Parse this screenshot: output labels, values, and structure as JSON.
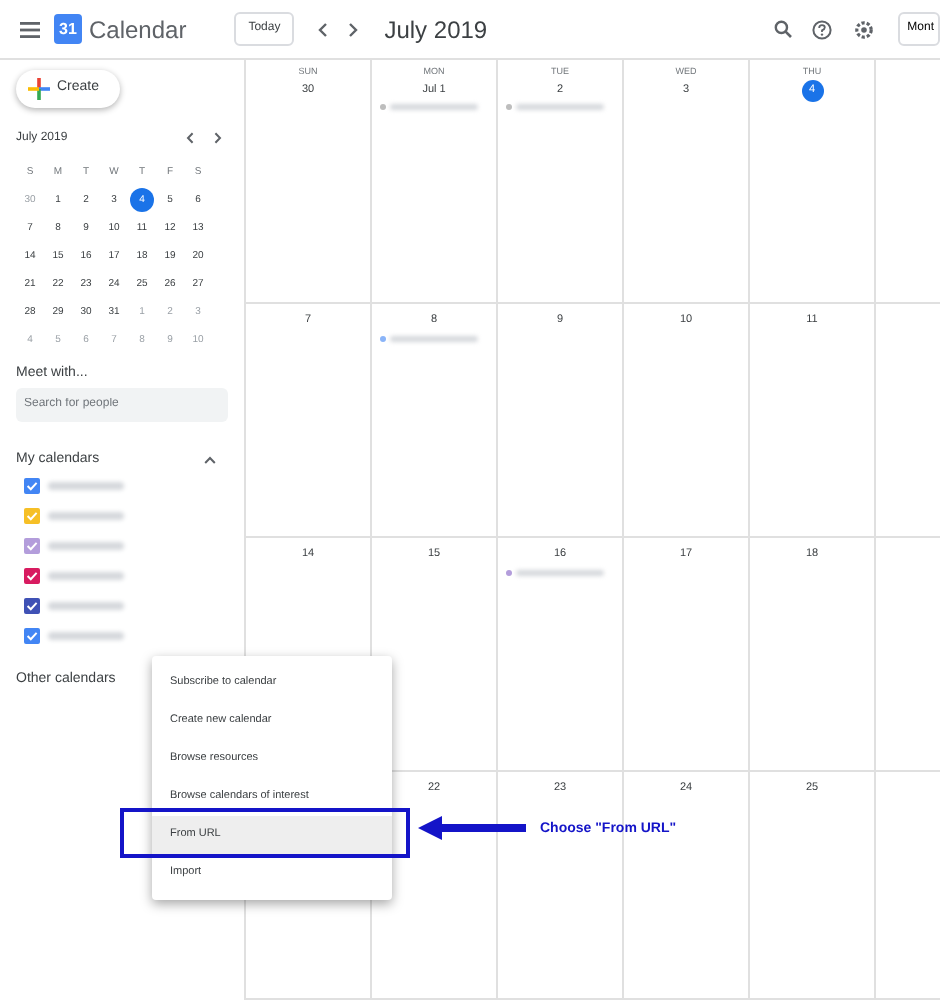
{
  "header": {
    "app_name": "Calendar",
    "logo_text": "31",
    "today_button": "Today",
    "title": "July 2019",
    "view_button": "Mont"
  },
  "create_button": "Create",
  "mini_calendar": {
    "title": "July 2019",
    "weekdays": [
      "S",
      "M",
      "T",
      "W",
      "T",
      "F",
      "S"
    ],
    "weeks": [
      [
        {
          "day": "30",
          "selected": false,
          "outside": true
        },
        {
          "day": "1",
          "selected": false,
          "outside": false
        },
        {
          "day": "2",
          "selected": false,
          "outside": false
        },
        {
          "day": "3",
          "selected": false,
          "outside": false
        },
        {
          "day": "4",
          "selected": true,
          "outside": false
        },
        {
          "day": "5",
          "selected": false,
          "outside": false
        },
        {
          "day": "6",
          "selected": false,
          "outside": false
        }
      ],
      [
        {
          "day": "7",
          "selected": false,
          "outside": false
        },
        {
          "day": "8",
          "selected": false,
          "outside": false
        },
        {
          "day": "9",
          "selected": false,
          "outside": false
        },
        {
          "day": "10",
          "selected": false,
          "outside": false
        },
        {
          "day": "11",
          "selected": false,
          "outside": false
        },
        {
          "day": "12",
          "selected": false,
          "outside": false
        },
        {
          "day": "13",
          "selected": false,
          "outside": false
        }
      ],
      [
        {
          "day": "14",
          "selected": false,
          "outside": false
        },
        {
          "day": "15",
          "selected": false,
          "outside": false
        },
        {
          "day": "16",
          "selected": false,
          "outside": false
        },
        {
          "day": "17",
          "selected": false,
          "outside": false
        },
        {
          "day": "18",
          "selected": false,
          "outside": false
        },
        {
          "day": "19",
          "selected": false,
          "outside": false
        },
        {
          "day": "20",
          "selected": false,
          "outside": false
        }
      ],
      [
        {
          "day": "21",
          "selected": false,
          "outside": false
        },
        {
          "day": "22",
          "selected": false,
          "outside": false
        },
        {
          "day": "23",
          "selected": false,
          "outside": false
        },
        {
          "day": "24",
          "selected": false,
          "outside": false
        },
        {
          "day": "25",
          "selected": false,
          "outside": false
        },
        {
          "day": "26",
          "selected": false,
          "outside": false
        },
        {
          "day": "27",
          "selected": false,
          "outside": false
        }
      ],
      [
        {
          "day": "28",
          "selected": false,
          "outside": false
        },
        {
          "day": "29",
          "selected": false,
          "outside": false
        },
        {
          "day": "30",
          "selected": false,
          "outside": false
        },
        {
          "day": "31",
          "selected": false,
          "outside": false
        },
        {
          "day": "1",
          "selected": false,
          "outside": true
        },
        {
          "day": "2",
          "selected": false,
          "outside": true
        },
        {
          "day": "3",
          "selected": false,
          "outside": true
        }
      ],
      [
        {
          "day": "4",
          "selected": false,
          "outside": true
        },
        {
          "day": "5",
          "selected": false,
          "outside": true
        },
        {
          "day": "6",
          "selected": false,
          "outside": true
        },
        {
          "day": "7",
          "selected": false,
          "outside": true
        },
        {
          "day": "8",
          "selected": false,
          "outside": true
        },
        {
          "day": "9",
          "selected": false,
          "outside": true
        },
        {
          "day": "10",
          "selected": false,
          "outside": true
        }
      ]
    ]
  },
  "meet_with": {
    "title": "Meet with...",
    "placeholder": "Search for people"
  },
  "my_calendars": {
    "title": "My calendars",
    "expanded": true,
    "items": [
      {
        "color": "#4285f4",
        "checked": true
      },
      {
        "color": "#f6bf26",
        "checked": true
      },
      {
        "color": "#b39ddb",
        "checked": true
      },
      {
        "color": "#d81b60",
        "checked": true
      },
      {
        "color": "#3f51b5",
        "checked": true
      },
      {
        "color": "#4285f4",
        "checked": true
      }
    ]
  },
  "other_calendars": {
    "title": "Other calendars"
  },
  "month_grid": {
    "weekdays": [
      "SUN",
      "MON",
      "TUE",
      "WED",
      "THU"
    ],
    "weeks": [
      [
        {
          "day": "30",
          "today": false
        },
        {
          "day": "Jul 1",
          "today": false,
          "events": [
            {
              "color": "#bdbdbd"
            }
          ]
        },
        {
          "day": "2",
          "today": false,
          "events": [
            {
              "color": "#bdbdbd"
            }
          ]
        },
        {
          "day": "3",
          "today": false
        },
        {
          "day": "4",
          "today": true
        },
        {
          "today": false
        }
      ],
      [
        {
          "day": "7",
          "today": false
        },
        {
          "day": "8",
          "today": false,
          "events": [
            {
              "color": "#8ab4f8"
            }
          ]
        },
        {
          "day": "9",
          "today": false
        },
        {
          "day": "10",
          "today": false
        },
        {
          "day": "11",
          "today": false
        },
        {
          "today": false
        }
      ],
      [
        {
          "day": "14",
          "today": false
        },
        {
          "day": "15",
          "today": false
        },
        {
          "day": "16",
          "today": false,
          "events": [
            {
              "color": "#b39ddb"
            }
          ]
        },
        {
          "day": "17",
          "today": false
        },
        {
          "day": "18",
          "today": false
        },
        {
          "today": false
        }
      ],
      [
        {
          "today": false
        },
        {
          "day": "22",
          "today": false
        },
        {
          "day": "23",
          "today": false
        },
        {
          "day": "24",
          "today": false
        },
        {
          "day": "25",
          "today": false
        },
        {
          "today": false
        }
      ]
    ]
  },
  "context_menu": {
    "items": [
      {
        "label": "Subscribe to calendar",
        "selected": false
      },
      {
        "label": "Create new calendar",
        "selected": false
      },
      {
        "label": "Browse resources",
        "selected": false
      },
      {
        "label": "Browse calendars of interest",
        "selected": false
      },
      {
        "label": "From URL",
        "selected": true
      },
      {
        "label": "Import",
        "selected": false
      }
    ]
  },
  "annotation": {
    "text": "Choose \"From URL\""
  }
}
